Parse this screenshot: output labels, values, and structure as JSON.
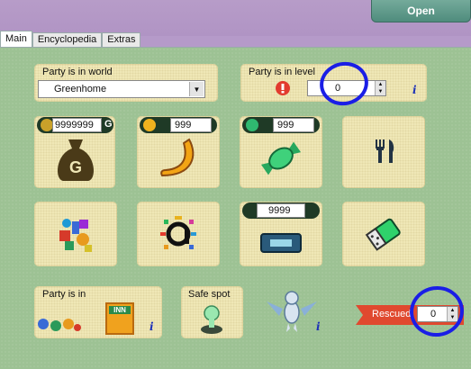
{
  "header": {
    "open_label": "Open"
  },
  "tabs": [
    "Main",
    "Encyclopedia",
    "Extras"
  ],
  "world": {
    "label": "Party is in world",
    "value": "Greenhome"
  },
  "level": {
    "label": "Party is in level",
    "value": "0"
  },
  "counters": {
    "gold": "9999999",
    "gold_suffix": "G",
    "bananas": "999",
    "candy": "999",
    "tickets": "9999"
  },
  "party_location": {
    "label": "Party is in",
    "building": "INN"
  },
  "safe_spot": {
    "label": "Safe spot"
  },
  "rescued": {
    "label": "Rescued",
    "value": "0"
  },
  "colors": {
    "panel": "#9dc294",
    "box": "#efe7b6",
    "annotation": "#1a1ee6",
    "ribbon": "#e0492f"
  }
}
